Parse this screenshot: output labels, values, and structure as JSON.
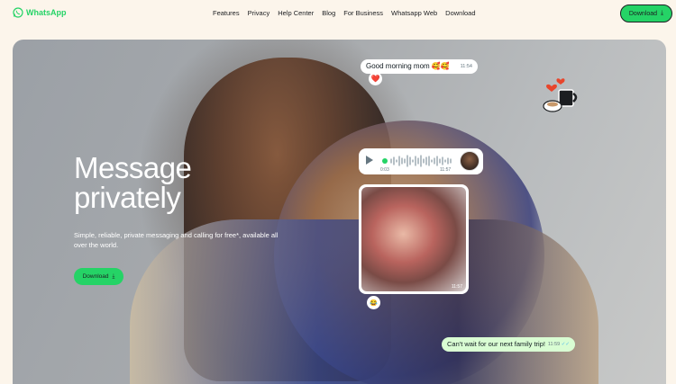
{
  "header": {
    "logo_text": "WhatsApp",
    "nav": [
      "Features",
      "Privacy",
      "Help Center",
      "Blog",
      "For Business",
      "Whatsapp Web",
      "Download"
    ],
    "download_label": "Download",
    "brand_color": "#25d366"
  },
  "hero": {
    "title_line1": "Message",
    "title_line2": "privately",
    "subtitle": "Simple, reliable, private messaging and calling for free*, available all over the world.",
    "download_label": "Download"
  },
  "chat": {
    "morning_text": "Good morning mom 🥰🥰",
    "morning_time": "11:54",
    "heart_reaction": "❤️",
    "voice_duration": "0:03",
    "voice_time": "11:57",
    "photo_time": "11:57",
    "face_reaction": "😂",
    "trip_text": "Can't wait for our next family trip!",
    "trip_time": "11:59"
  }
}
